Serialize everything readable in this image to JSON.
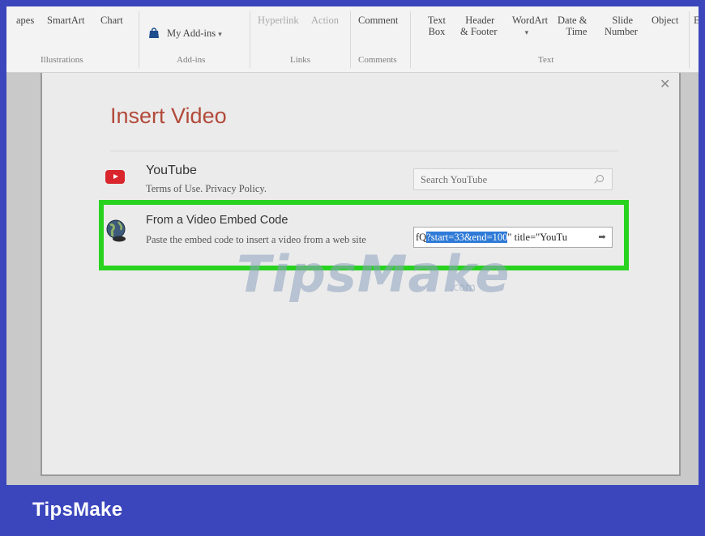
{
  "ribbon": {
    "illustrations": {
      "shapes_label": "apes",
      "smartart_label": "SmartArt",
      "chart_label": "Chart",
      "group_label": "Illustrations"
    },
    "addins": {
      "my_addins_label": "My Add-ins",
      "group_label": "Add-ins"
    },
    "links": {
      "hyperlink_label": "Hyperlink",
      "action_label": "Action",
      "group_label": "Links"
    },
    "comments": {
      "comment_label": "Comment",
      "group_label": "Comments"
    },
    "text": {
      "textbox_line1": "Text",
      "textbox_line2": "Box",
      "header_line1": "Header",
      "header_line2": "& Footer",
      "wordart_label": "WordArt",
      "datetime_line1": "Date &",
      "datetime_line2": "Time",
      "slide_line1": "Slide",
      "slide_line2": "Number",
      "object_label": "Object",
      "group_label": "Text"
    },
    "truncated_label": "E"
  },
  "dialog": {
    "title": "Insert Video",
    "close_icon": "close-icon",
    "youtube": {
      "title": "YouTube",
      "terms": "Terms of Use. Privacy Policy.",
      "search_placeholder": "Search YouTube"
    },
    "embed": {
      "title": "From a Video Embed Code",
      "description": "Paste the embed code to insert a video from a web site",
      "input_prefix": "fQ",
      "input_selected": "?start=33&end=100",
      "input_suffix": "\" title=\"YouTu"
    }
  },
  "watermark": {
    "text": "TipsMake",
    "suffix": ".com"
  },
  "brand": {
    "name": "TipsMake",
    "bar_color": "#3b46bd",
    "highlight_color": "#27d31f",
    "title_color": "#b24a3a"
  }
}
